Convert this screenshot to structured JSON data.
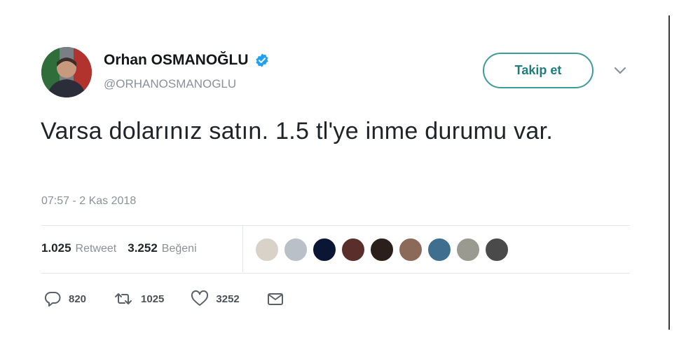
{
  "author": {
    "display_name": "Orhan OSMANOĞLU",
    "handle": "@ORHANOSMANOGLU",
    "verified": true
  },
  "follow_button": {
    "label": "Takip et"
  },
  "tweet": {
    "text": "Varsa dolarınız satın. 1.5 tl'ye inme durumu var.",
    "timestamp": "07:57 - 2 Kas 2018"
  },
  "stats": {
    "retweet_count": "1.025",
    "retweet_label": "Retweet",
    "like_count": "3.252",
    "like_label": "Beğeni"
  },
  "likers": [
    {
      "name": "liker-1",
      "color": "#d9d2c8"
    },
    {
      "name": "liker-2",
      "color": "#b9c0c8"
    },
    {
      "name": "liker-3",
      "color": "#0a1633"
    },
    {
      "name": "liker-4",
      "color": "#5a2e2a"
    },
    {
      "name": "liker-5",
      "color": "#2a1f1a"
    },
    {
      "name": "liker-6",
      "color": "#8b6a5a"
    },
    {
      "name": "liker-7",
      "color": "#3f6f8f"
    },
    {
      "name": "liker-8",
      "color": "#9a9a90"
    },
    {
      "name": "liker-9",
      "color": "#4a4a4a"
    }
  ],
  "actions": {
    "reply_count": "820",
    "retweet_count": "1025",
    "like_count": "3252"
  },
  "icons": {
    "verified": "verified-badge-icon",
    "menu": "chevron-down-icon",
    "reply": "reply-icon",
    "retweet": "retweet-icon",
    "like": "heart-icon",
    "dm": "envelope-icon"
  },
  "colors": {
    "verified": "#1da1f2",
    "follow_border": "#3c9c9a",
    "muted": "#8a9199",
    "text": "#1f2429"
  }
}
